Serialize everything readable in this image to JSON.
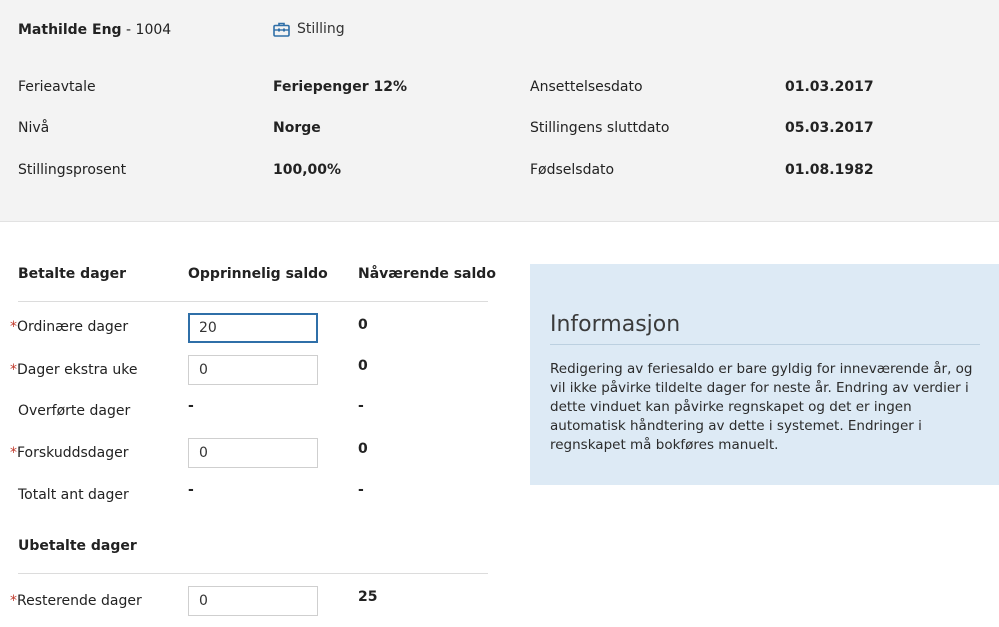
{
  "employee": {
    "name": "Mathilde Eng",
    "id_suffix": " - 1004",
    "position_link": "Stilling"
  },
  "details": {
    "left": [
      {
        "label": "Ferieavtale",
        "value": "Feriepenger 12%"
      },
      {
        "label": "Nivå",
        "value": "Norge"
      },
      {
        "label": "Stillingsprosent",
        "value": "100,00%"
      }
    ],
    "right": [
      {
        "label": "Ansettelsesdato",
        "value": "01.03.2017"
      },
      {
        "label": "Stillingens sluttdato",
        "value": "05.03.2017"
      },
      {
        "label": "Fødselsdato",
        "value": "01.08.1982"
      }
    ]
  },
  "table": {
    "headers": {
      "category": "Betalte dager",
      "original": "Opprinnelig saldo",
      "current": "Nåværende saldo"
    },
    "required_mark": "*",
    "rows": [
      {
        "label": "Ordinære dager",
        "original": "20",
        "current": "0"
      },
      {
        "label": "Dager ekstra uke",
        "original": "0",
        "current": "0"
      },
      {
        "label": "Overførte dager",
        "original": "-",
        "current": "-"
      },
      {
        "label": "Forskuddsdager",
        "original": "0",
        "current": "0"
      },
      {
        "label": "Totalt ant dager",
        "original": "-",
        "current": "-"
      }
    ],
    "unpaid_header": "Ubetalte dager",
    "unpaid_rows": [
      {
        "label": "Resterende dager",
        "original": "0",
        "current": "25"
      }
    ]
  },
  "info": {
    "title": "Informasjon",
    "text": "Redigering av feriesaldo er bare gyldig for inneværende år, og vil ikke påvirke tildelte dager for neste år. Endring av verdier i dette vinduet kan påvirke regnskapet og det er ingen automatisk håndtering av dette i systemet. Endringer i regnskapet må bokføres manuelt."
  },
  "colors": {
    "header_bg": "#f3f3f3",
    "info_bg": "#ddeaf5",
    "focus_border": "#2f6fa8",
    "required": "#c0392b",
    "icon": "#2f6fa8"
  }
}
